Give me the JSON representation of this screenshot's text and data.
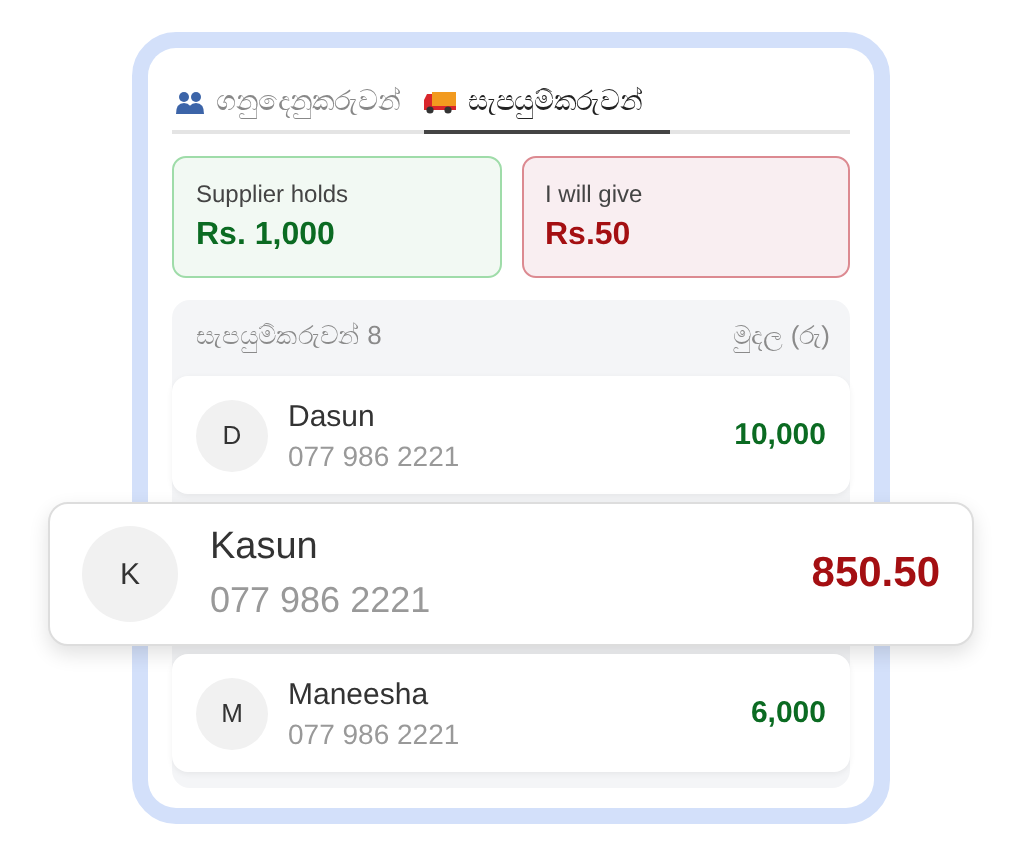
{
  "tabs": [
    {
      "label": "ගනුදෙනුකරුවන්",
      "kind": "customers",
      "selected": false
    },
    {
      "label": "සැපයුම්කරුවන්",
      "kind": "suppliers",
      "selected": true
    }
  ],
  "summary": [
    {
      "label": "Supplier holds",
      "value": "Rs. 1,000",
      "kind": "receive"
    },
    {
      "label": "I will give",
      "value": "Rs.50",
      "kind": "give"
    }
  ],
  "list": {
    "count_label": "සැපයුම්කරුවන් 8",
    "amount_label": "මුදල (රු)",
    "rows": [
      {
        "initial": "D",
        "name": "Dasun",
        "phone": "077 986 2221",
        "amount": "10,000",
        "kind": "receive",
        "highlighted": false
      },
      {
        "initial": "K",
        "name": "Kasun",
        "phone": "077 986 2221",
        "amount": "850.50",
        "kind": "give",
        "highlighted": true
      },
      {
        "initial": "M",
        "name": "Maneesha",
        "phone": "077 986 2221",
        "amount": "6,000",
        "kind": "receive",
        "highlighted": false
      }
    ]
  }
}
